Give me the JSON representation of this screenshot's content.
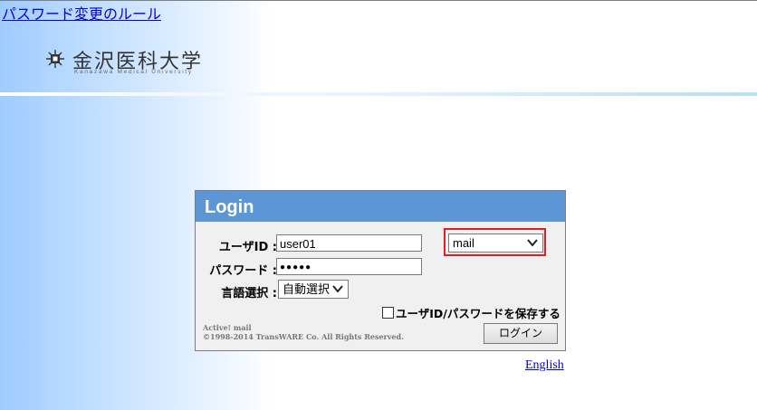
{
  "top": {
    "rule_link": "パスワード変更のルール"
  },
  "logo": {
    "title": "金沢医科大学",
    "subtitle": "Kanazawa Medical University"
  },
  "login": {
    "header": "Login",
    "user_id_label": "ユーザID :",
    "user_id_value": "user01",
    "password_label": "パスワード :",
    "password_value": "●●●●●",
    "language_label": "言語選択 :",
    "language_value": "自動選択",
    "service_value": "mail",
    "save_label": "ユーザID/パスワードを保存する",
    "copyright_line1": "Active! mail",
    "copyright_line2": "©1998-2014 TransWARE Co. All Rights Reserved.",
    "login_button": "ログイン"
  },
  "footer": {
    "english_link": "English"
  },
  "colors": {
    "header_blue": "#5c96d6",
    "highlight_red": "#e02020",
    "link_blue": "#0000ee"
  },
  "icons": {
    "select_arrow": "chevron-down-icon",
    "logo_mark": "university-crest-icon"
  }
}
